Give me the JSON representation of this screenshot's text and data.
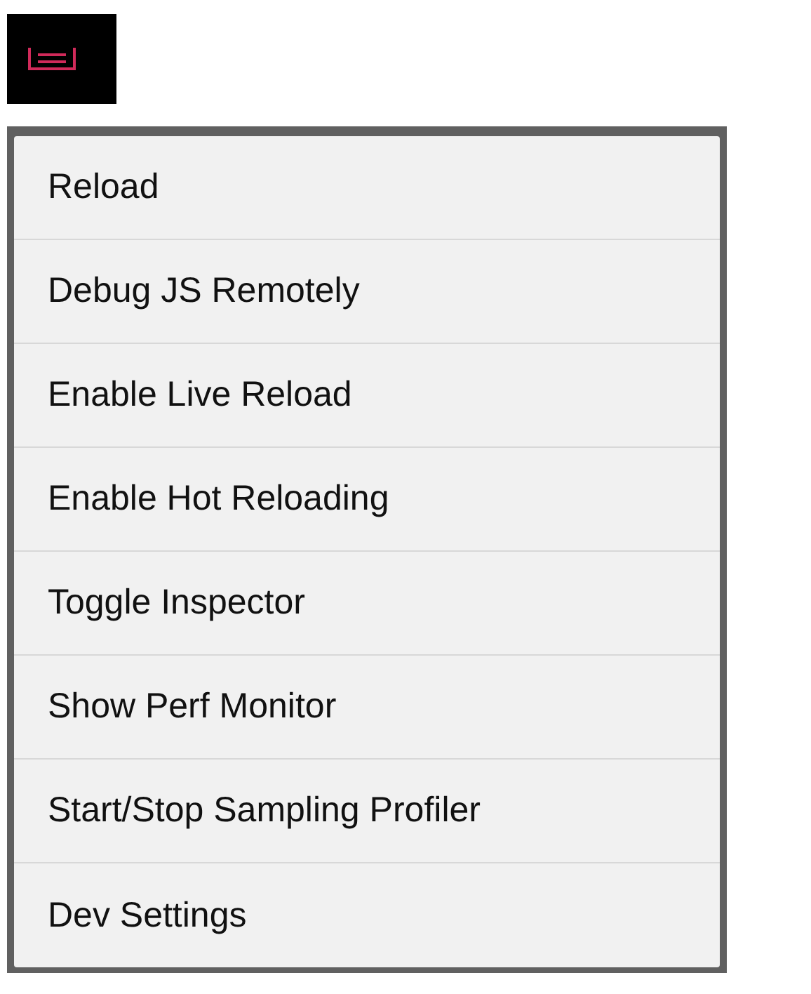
{
  "menu": {
    "items": [
      {
        "label": "Reload"
      },
      {
        "label": "Debug JS Remotely"
      },
      {
        "label": "Enable Live Reload"
      },
      {
        "label": "Enable Hot Reloading"
      },
      {
        "label": "Toggle Inspector"
      },
      {
        "label": "Show Perf Monitor"
      },
      {
        "label": "Start/Stop Sampling Profiler"
      },
      {
        "label": "Dev Settings"
      }
    ]
  }
}
